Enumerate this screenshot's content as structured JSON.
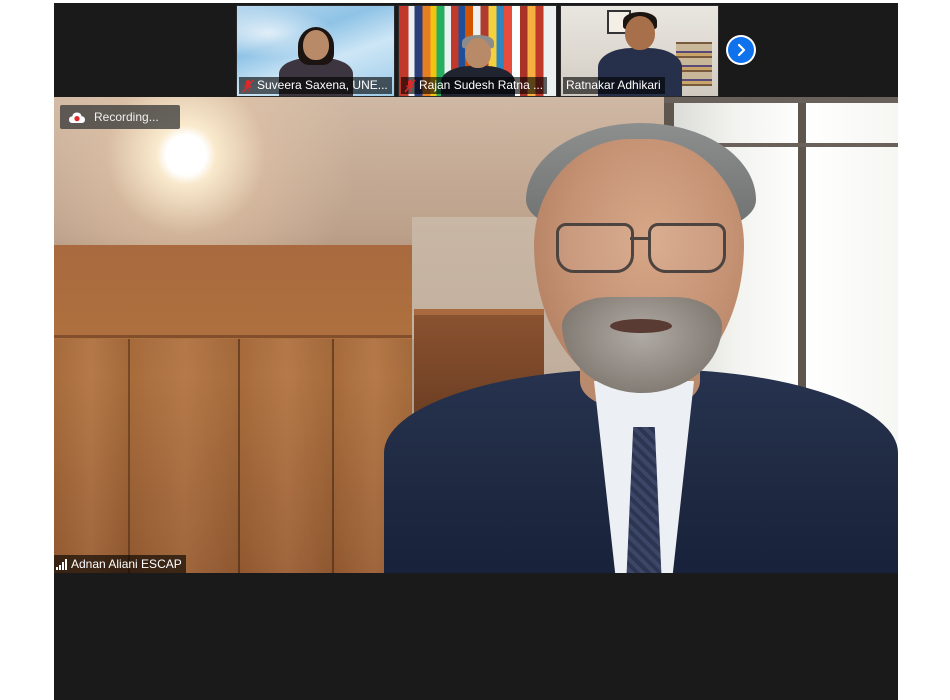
{
  "thumbnails": [
    {
      "name": "Suveera Saxena, UNE...",
      "muted": true
    },
    {
      "name": "Rajan Sudesh Ratna ...",
      "muted": true
    },
    {
      "name": "Ratnakar Adhikari",
      "muted": false
    }
  ],
  "controls": {
    "next_page_icon": "chevron-right-icon"
  },
  "recording": {
    "label": "Recording...",
    "icon": "cloud-recording-icon"
  },
  "active_speaker": {
    "name": "Adnan Aliani ESCAP",
    "signal_icon": "signal-bars-icon"
  },
  "colors": {
    "window_bg": "#1a1a1a",
    "accent_blue": "#0e72ed",
    "muted_red": "#e02828"
  }
}
